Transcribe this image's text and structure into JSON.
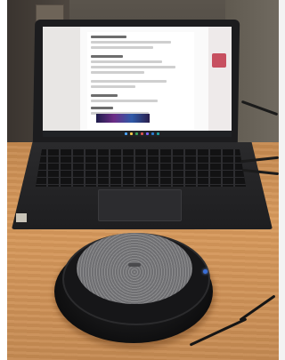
{
  "scene": {
    "subjects": [
      {
        "name": "laptop",
        "state": "open",
        "screen_app": "document-editor"
      },
      {
        "name": "speakerphone",
        "status_light_color": "#3a6fd8"
      }
    ],
    "surface": "wooden-table",
    "colors": {
      "table": "#d89a5c",
      "laptop_body": "#1e1e20",
      "speaker_mesh": "#7a7a7d",
      "wall": "#4a443d"
    }
  }
}
